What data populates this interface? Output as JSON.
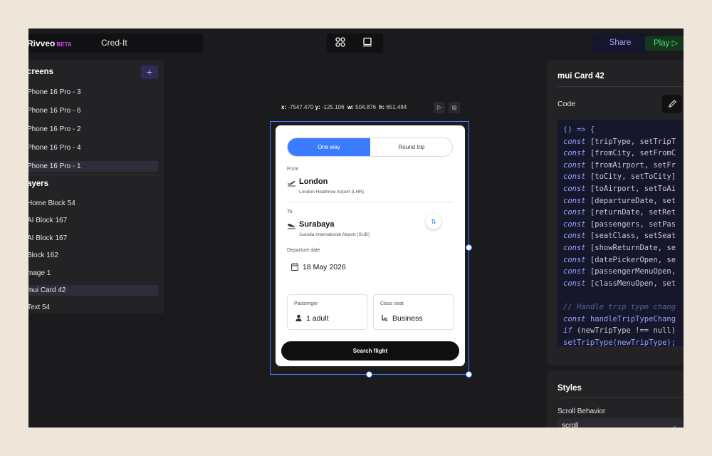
{
  "app": {
    "brand": "Rivveo",
    "beta": "BETA",
    "project": "Cred-It",
    "share": "Share",
    "play": "Play ▷"
  },
  "screens": {
    "title": "creens",
    "items": [
      "Phone 16 Pro - 3",
      "Phone 16 Pro - 6",
      "Phone 16 Pro - 2",
      "Phone 16 Pro - 4",
      "Phone 16 Pro - 1"
    ]
  },
  "layers": {
    "title": "ayers",
    "items": [
      "Home Block 54",
      "AI Block 167",
      "AI Block 167",
      "Block 162",
      "mage 1",
      "mui Card 42",
      "Text 54"
    ],
    "selected_index": 5
  },
  "canvas": {
    "x_label": "x:",
    "x": "-7547.470",
    "y_label": "y:",
    "y": "-125.106",
    "w_label": "w:",
    "w": "504.876",
    "h_label": "h:",
    "h": "651.484"
  },
  "card": {
    "tab_one_way": "One way",
    "tab_round_trip": "Round trip",
    "from_label": "From",
    "from_city": "London",
    "from_airport": "London Heathrow Airport (LHR)",
    "to_label": "To",
    "to_city": "Surabaya",
    "to_airport": "Juanda International Airport (SUB)",
    "swap": "⇅",
    "date_label": "Departure date",
    "date": "18 May 2026",
    "passenger_label": "Passenger",
    "passenger_value": "1 adult",
    "class_label": "Class seat",
    "class_value": "Business",
    "search": "Search flight"
  },
  "inspector": {
    "title": "mui Card 42",
    "code_label": "Code",
    "styles_title": "Styles",
    "scroll_label": "Scroll Behavior",
    "scroll_value": "scroll"
  },
  "code_lines": [
    "() => {",
    "const [tripType, setTripT",
    "const [fromCity, setFromC",
    "const [fromAirport, setFr",
    "const [toCity, setToCity]",
    "const [toAirport, setToAi",
    "const [departureDate, set",
    "const [returnDate, setRet",
    "const [passengers, setPas",
    "const [seatClass, setSeat",
    "const [showReturnDate, se",
    "const [datePickerOpen, se",
    "const [passengerMenuOpen,",
    "const [classMenuOpen, set",
    "",
    "// Handle trip type chang",
    "const handleTripTypeChang",
    "if (newTripType !== null)",
    "setTripType(newTripType);"
  ],
  "colors": {
    "accent": "#3b7bff",
    "brand_beta": "#d946ef",
    "play_green": "#4ade80",
    "selection": "#3b82f6"
  }
}
